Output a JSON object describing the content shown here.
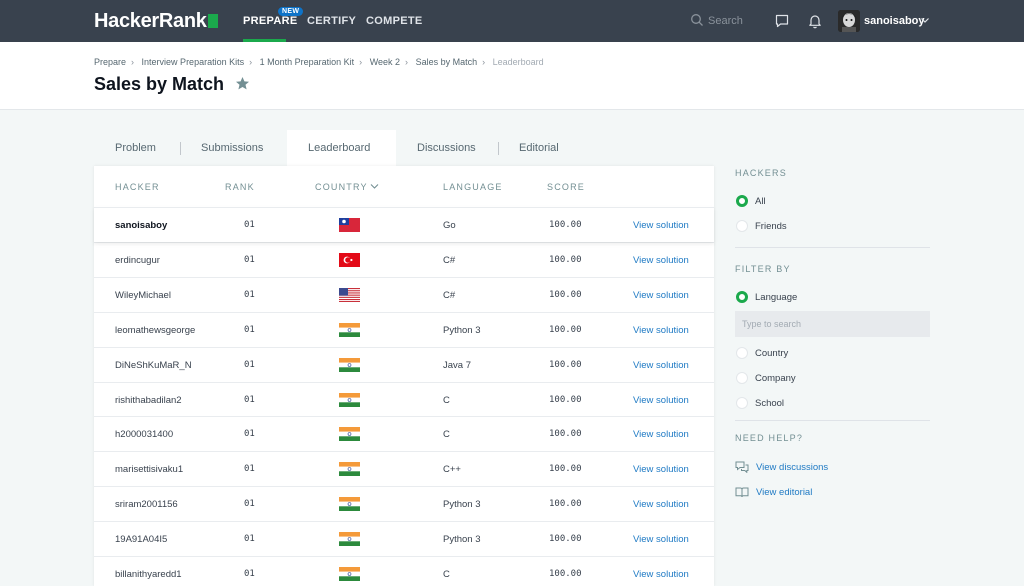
{
  "nav": {
    "logo": "HackerRank",
    "prepare": "PREPARE",
    "new_badge": "NEW",
    "certify": "CERTIFY",
    "compete": "COMPETE",
    "search_placeholder": "Search",
    "username": "sanoisaboy"
  },
  "breadcrumb": [
    "Prepare",
    "Interview Preparation Kits",
    "1 Month Preparation Kit",
    "Week 2",
    "Sales by Match",
    "Leaderboard"
  ],
  "page_title": "Sales by Match",
  "tabs": [
    "Problem",
    "Submissions",
    "Leaderboard",
    "Discussions",
    "Editorial"
  ],
  "active_tab": "Leaderboard",
  "table": {
    "headers": [
      "HACKER",
      "RANK",
      "COUNTRY",
      "LANGUAGE",
      "SCORE"
    ],
    "link_label": "View solution",
    "rows": [
      {
        "hacker": "sanoisaboy",
        "rank": "01",
        "country": "taiwan",
        "language": "Go",
        "score": "100.00"
      },
      {
        "hacker": "erdincugur",
        "rank": "01",
        "country": "turkey",
        "language": "C#",
        "score": "100.00"
      },
      {
        "hacker": "WileyMichael",
        "rank": "01",
        "country": "usa",
        "language": "C#",
        "score": "100.00"
      },
      {
        "hacker": "leomathewsgeorge",
        "rank": "01",
        "country": "india",
        "language": "Python 3",
        "score": "100.00"
      },
      {
        "hacker": "DiNeShKuMaR_N",
        "rank": "01",
        "country": "india",
        "language": "Java 7",
        "score": "100.00"
      },
      {
        "hacker": "rishithabadilan2",
        "rank": "01",
        "country": "india",
        "language": "C",
        "score": "100.00"
      },
      {
        "hacker": "h2000031400",
        "rank": "01",
        "country": "india",
        "language": "C",
        "score": "100.00"
      },
      {
        "hacker": "marisettisivaku1",
        "rank": "01",
        "country": "india",
        "language": "C++",
        "score": "100.00"
      },
      {
        "hacker": "sriram2001156",
        "rank": "01",
        "country": "india",
        "language": "Python 3",
        "score": "100.00"
      },
      {
        "hacker": "19A91A04I5",
        "rank": "01",
        "country": "india",
        "language": "Python 3",
        "score": "100.00"
      },
      {
        "hacker": "billanithyaredd1",
        "rank": "01",
        "country": "india",
        "language": "C",
        "score": "100.00"
      }
    ]
  },
  "sidebar": {
    "hackers_heading": "HACKERS",
    "hackers_options": [
      "All",
      "Friends"
    ],
    "hackers_selected": "All",
    "filter_heading": "FILTER BY",
    "filter_options": [
      "Language",
      "Country",
      "Company",
      "School"
    ],
    "filter_selected": "Language",
    "filter_placeholder": "Type to search",
    "help_heading": "NEED HELP?",
    "help_links": [
      "View discussions",
      "View editorial"
    ]
  },
  "colors": {
    "nav_bg": "#39424e",
    "accent_green": "#1ba94c",
    "link_blue": "#1f7ac4",
    "badge_blue": "#0e73c8"
  }
}
